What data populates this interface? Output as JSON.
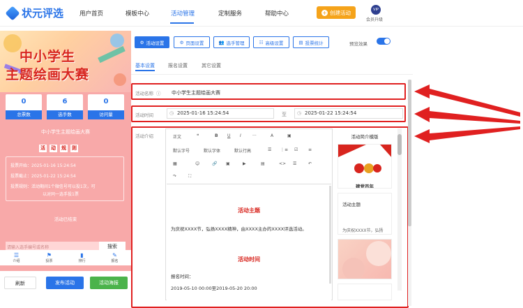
{
  "header": {
    "logo_text": "状元评选",
    "nav": [
      "用户首页",
      "模板中心",
      "活动管理",
      "定制服务",
      "帮助中心"
    ],
    "active_nav": "活动管理",
    "create_button": "创建活动",
    "vip_badge": "VIP",
    "vip_label": "会员升级"
  },
  "preview": {
    "banner_title_line1": "中小学生",
    "banner_title_line2": "主题绘画大赛",
    "stats": [
      {
        "value": "0",
        "label": "总票数"
      },
      {
        "value": "6",
        "label": "选手数"
      },
      {
        "value": "0",
        "label": "访问量"
      }
    ],
    "activity_name": "中小学生主题绘画大赛",
    "rules_chars": [
      "活",
      "动",
      "规",
      "则"
    ],
    "info_lines": [
      "投票开始：2025-01-16 15:24:54",
      "投票截止：2025-01-22 15:24:54",
      "投票规则：活动期间1个微信号可以投1次，可",
      "以对同一选手投1票"
    ],
    "vote_end": "活动已结束",
    "search_placeholder": "请输入选手编号或名称",
    "search_button": "搜索",
    "tabs": [
      "介绍",
      "投票",
      "排行",
      "报名"
    ]
  },
  "bottom_actions": {
    "refresh": "刷新",
    "publish": "发布活动",
    "poster": "活动海报"
  },
  "toolbar": {
    "buttons": [
      "活动设置",
      "页面设置",
      "选手管理",
      "高级设置",
      "投票统计"
    ],
    "active": "活动设置",
    "preview_label": "预览效果"
  },
  "subtabs": [
    "基本设置",
    "报名设置",
    "其它设置"
  ],
  "form": {
    "name_label": "活动名称",
    "name_value": "中小学生主题绘画大赛",
    "time_label": "活动时间",
    "start_time": "2025-01-16 15:24:54",
    "range_sep": "至",
    "end_time": "2025-01-22 15:24:54",
    "intro_label": "活动介绍"
  },
  "editor": {
    "tools_row1": [
      "正文",
      "❝",
      "B",
      "U",
      "I",
      "···",
      "A",
      "▣"
    ],
    "tools_row2": [
      "默认字号",
      "默认字体",
      "默认行高",
      "☰",
      "⋮≡",
      "☑",
      "≡"
    ],
    "tools_row3": [
      "▦",
      "☺",
      "🔗",
      "▣",
      "▶",
      "▤",
      "<>",
      "☰",
      "↶"
    ],
    "tools_row4": [
      "↷",
      "⛶"
    ],
    "content_title1": "活动主题",
    "content_text1": "为庆祝XXXX节，弘扬XXXX精神，由XXXX主办的XXXX评选活动。",
    "content_title2": "活动时间",
    "content_text2": "报名时间：",
    "content_text3": "2019-05-10 00:00至2019-05-20 20:00"
  },
  "templates": {
    "title": "活动简介模版",
    "items": [
      {
        "caption": "建党百年"
      },
      {
        "caption": "活动主题",
        "sub": "为庆祝XXXX节，弘扬"
      },
      {
        "caption": ""
      }
    ]
  }
}
